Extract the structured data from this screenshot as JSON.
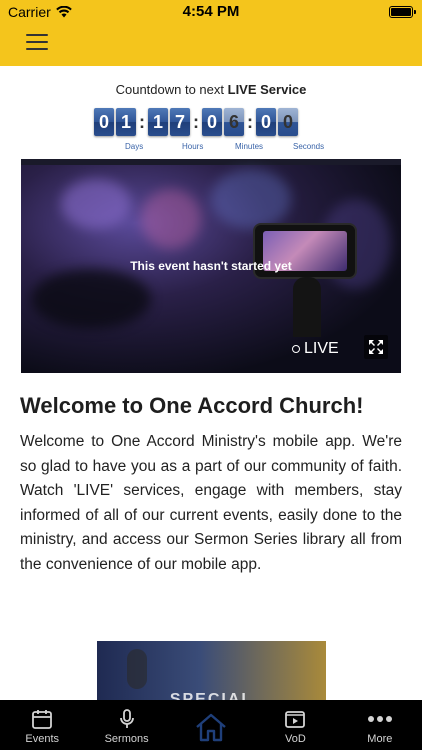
{
  "status_bar": {
    "carrier": "Carrier",
    "time": "4:54 PM"
  },
  "countdown": {
    "prefix": "Countdown to next ",
    "bold": "LIVE Service",
    "days": [
      "0",
      "1"
    ],
    "hours": [
      "1",
      "7"
    ],
    "minutes": [
      "0",
      "6"
    ],
    "seconds": [
      "0",
      "0"
    ],
    "labels": {
      "days": "Days",
      "hours": "Hours",
      "minutes": "Minutes",
      "seconds": "Seconds"
    }
  },
  "video": {
    "message": "This event hasn't started yet",
    "live_label": "LIVE"
  },
  "welcome": {
    "title": "Welcome to One Accord Church!",
    "body": "Welcome to One Accord Ministry's mobile app. We're so glad to have you as a part of our community of faith. Watch 'LIVE' services, engage with members, stay informed of all of our current events, easily done to the ministry, and access our Sermon Series library all from the convenience of our mobile app."
  },
  "banner": {
    "text": "SPECIAL"
  },
  "tabs": [
    {
      "label": "Events",
      "icon": "calendar-icon"
    },
    {
      "label": "Sermons",
      "icon": "microphone-icon"
    },
    {
      "label": "",
      "icon": "home-icon",
      "active": true
    },
    {
      "label": "VoD",
      "icon": "video-icon"
    },
    {
      "label": "More",
      "icon": "more-dots-icon"
    }
  ],
  "colors": {
    "header": "#f4c51c",
    "digit": "#2f5496",
    "tabbar": "#000000",
    "home_active": "#1f3f7a"
  }
}
